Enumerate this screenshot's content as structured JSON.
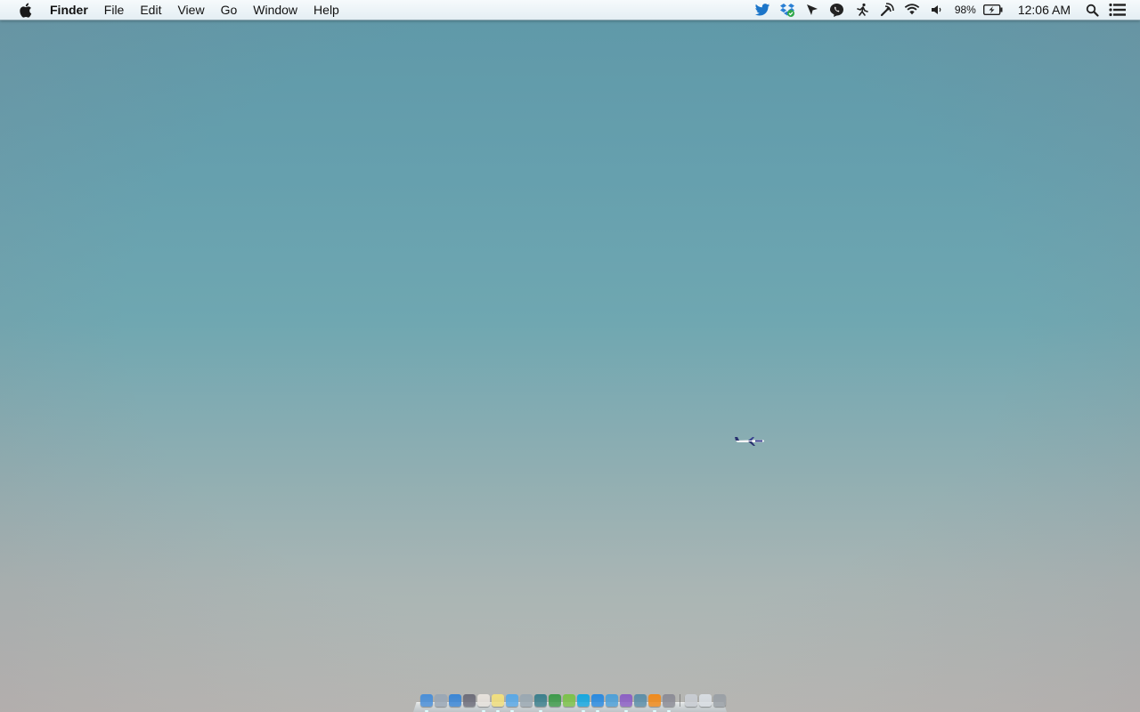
{
  "menubar": {
    "apple_icon": "apple-logo",
    "app_name": "Finder",
    "menus": [
      "File",
      "Edit",
      "View",
      "Go",
      "Window",
      "Help"
    ],
    "status_icons": [
      {
        "name": "twitter-icon",
        "color": "#1b75c9"
      },
      {
        "name": "dropbox-sync-icon",
        "color": "#2a7fd4"
      },
      {
        "name": "cursor-arrow-icon",
        "color": "#222222"
      },
      {
        "name": "viber-icon",
        "color": "#222222"
      },
      {
        "name": "running-figure-icon",
        "color": "#222222"
      },
      {
        "name": "antenna-icon",
        "color": "#222222"
      },
      {
        "name": "wifi-icon",
        "color": "#222222"
      },
      {
        "name": "volume-icon",
        "color": "#222222"
      }
    ],
    "battery_percent": "98%",
    "battery_icon": "battery-charging-icon",
    "clock": "12:06 AM",
    "spotlight_icon": "search-icon",
    "notification_icon": "list-icon"
  },
  "dock": {
    "apps": [
      {
        "name": "finder",
        "color": "#4a8fd8"
      },
      {
        "name": "launchpad",
        "color": "#9aa7b5"
      },
      {
        "name": "app-store",
        "color": "#3a86d6"
      },
      {
        "name": "mission-control",
        "color": "#6d6d7a"
      },
      {
        "name": "calendar",
        "color": "#e7e2dc"
      },
      {
        "name": "notes",
        "color": "#f1df7e"
      },
      {
        "name": "safari",
        "color": "#5aa8e6"
      },
      {
        "name": "preview",
        "color": "#9aa8b2"
      },
      {
        "name": "photo-app",
        "color": "#3c7f8c"
      },
      {
        "name": "numbers",
        "color": "#3e9a4a"
      },
      {
        "name": "evernote",
        "color": "#7cc24a"
      },
      {
        "name": "skype",
        "color": "#16a7e0"
      },
      {
        "name": "twitter",
        "color": "#2a8ae0"
      },
      {
        "name": "sparrow",
        "color": "#4ea0d8"
      },
      {
        "name": "viber",
        "color": "#8c5fc4"
      },
      {
        "name": "image-capture",
        "color": "#5c8ea8"
      },
      {
        "name": "vlc",
        "color": "#f08a1c"
      },
      {
        "name": "system-preferences",
        "color": "#8c8c96"
      }
    ],
    "others": [
      {
        "name": "documents-stack",
        "color": "#c8ccd2"
      },
      {
        "name": "downloads-stack",
        "color": "#d8dde2"
      },
      {
        "name": "trash",
        "color": "#9aa0a6"
      }
    ]
  }
}
